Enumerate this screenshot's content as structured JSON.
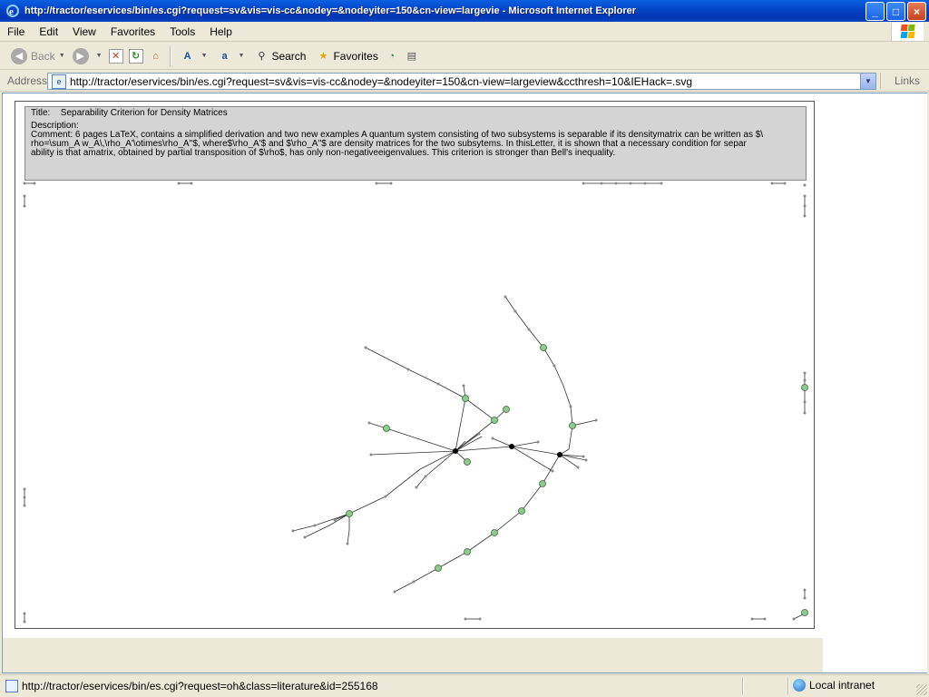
{
  "window": {
    "title": "http://tractor/eservices/bin/es.cgi?request=sv&vis=vis-cc&nodey=&nodeyiter=150&cn-view=largevie - Microsoft Internet Explorer",
    "minimize": "_",
    "maximize": "□",
    "close": "×"
  },
  "menu": [
    "File",
    "Edit",
    "View",
    "Favorites",
    "Tools",
    "Help"
  ],
  "toolbar": {
    "back": "Back",
    "search": "Search",
    "favorites": "Favorites"
  },
  "address": {
    "label": "Address",
    "url": "http://tractor/eservices/bin/es.cgi?request=sv&vis=vis-cc&nodey=&nodeyiter=150&cn-view=largeview&ccthresh=10&IEHack=.svg",
    "links": "Links"
  },
  "document": {
    "title_label": "Title:",
    "title": "Separability Criterion for Density Matrices",
    "description_label": "Description:",
    "comment": "Comment: 6 pages LaTeX, contains a simplified derivation and two new examples A quantum system consisting of two subsystems is separable if its densitymatrix can be written as $\\\nrho=\\sum_A w_A\\,\\rho_A'\\otimes\\rho_A''$, where$\\rho_A'$ and $\\rho_A''$ are density matrices for the two subsytems. In thisLetter, it is shown that a necessary condition for separ\nability is that amatrix, obtained by partial transposition of $\\rho$, has only non-negativeeigenvalues. This criterion is stronger than Bell's inequality."
  },
  "status": {
    "url": "http://tractor/eservices/bin/es.cgi?request=oh&class=literature&id=255168",
    "zone": "Local intranet"
  },
  "colors": {
    "node_fill": "#8fc98f",
    "node_stroke": "#2f6b2f",
    "edge": "#333333",
    "hub": "#000000"
  }
}
